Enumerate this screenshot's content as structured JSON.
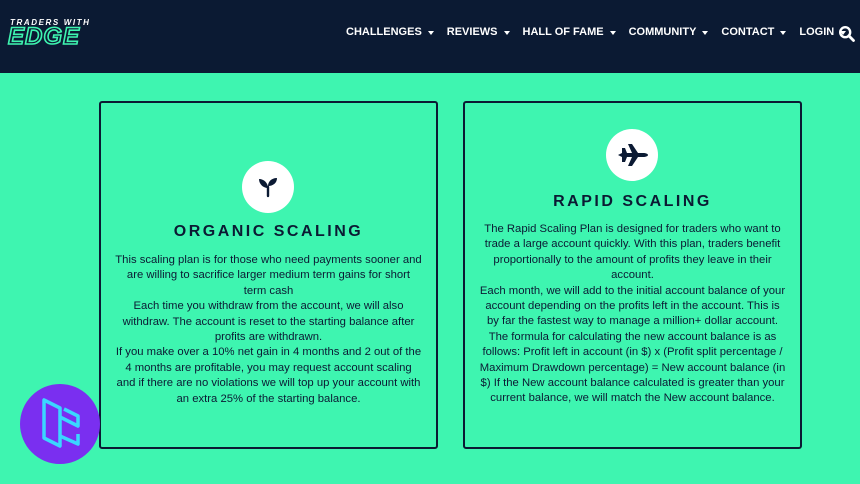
{
  "header": {
    "logo_top": "TRADERS WITH",
    "logo_main": "EDGE",
    "nav": [
      "CHALLENGES",
      "REVIEWS",
      "HALL OF FAME",
      "COMMUNITY",
      "CONTACT",
      "LOGIN"
    ],
    "search_icon": "search-icon"
  },
  "colors": {
    "background": "#3ef5b0",
    "navbar": "#0b1a33",
    "badge": "#7a2ff0"
  },
  "organic": {
    "icon": "sprout-icon",
    "title": "ORGANIC SCALING",
    "paragraphs": [
      "This scaling plan is for those who need payments sooner and are willing to sacrifice larger medium term gains for short term cash",
      "Each time you withdraw from the account, we will also withdraw. The account is reset to the starting balance after profits are withdrawn.",
      "If you make over a 10% net gain in 4 months and 2 out of the 4 months are profitable, you may request account scaling and if there are no violations we will top up your account with an extra 25% of the starting balance."
    ]
  },
  "rapid": {
    "icon": "fighter-jet-icon",
    "title": "RAPID SCALING",
    "paragraphs": [
      "The Rapid Scaling Plan is designed for traders who want to trade a large account quickly. With this plan, traders benefit proportionally to the amount of profits they leave in their account.",
      "Each month, we will add to the initial account balance of your account depending on the profits left in the account. This is by far the fastest way to manage a million+ dollar account.",
      "The formula for calculating the new account balance is as follows: Profit left in account (in $) x (Profit split percentage / Maximum Drawdown percentage) = New account balance (in $)  If the New account balance calculated is greater than your current balance, we will match the New account balance."
    ]
  },
  "badge_icon": "tc-logo-icon"
}
